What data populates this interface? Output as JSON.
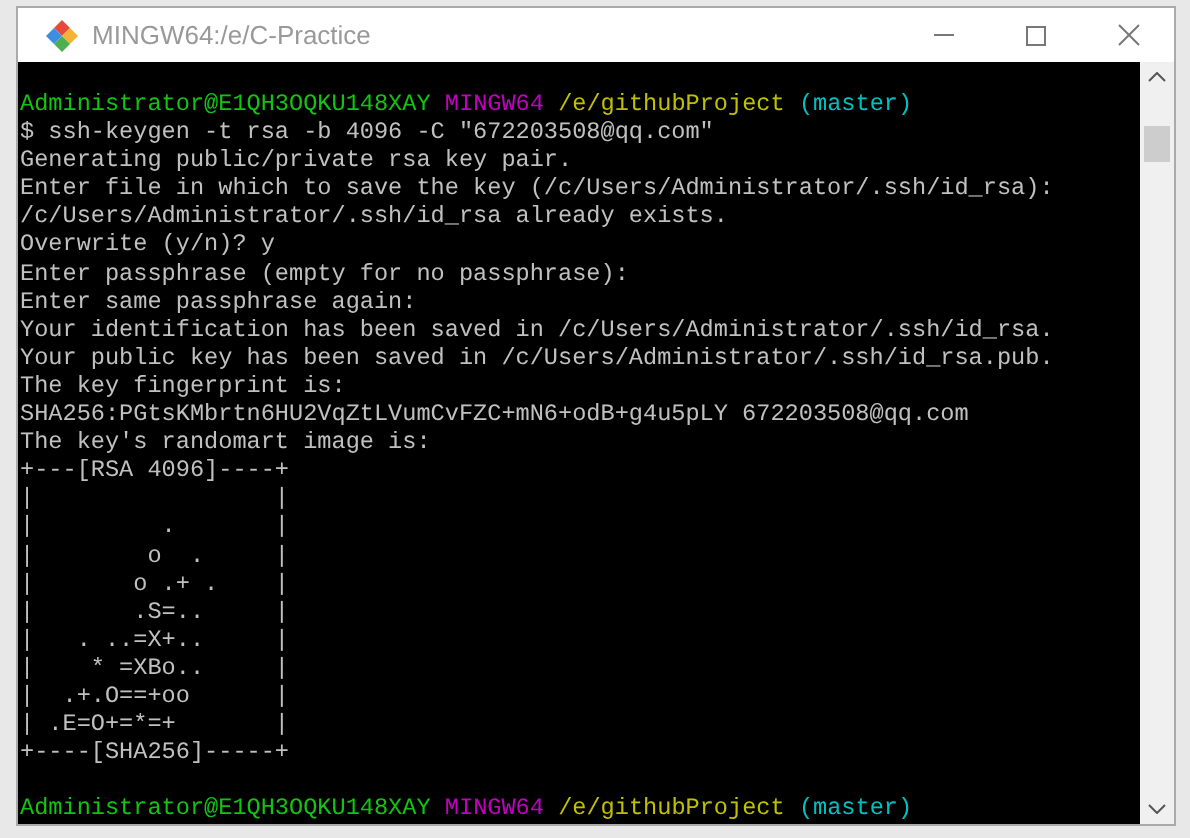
{
  "window": {
    "title": "MINGW64:/e/C-Practice"
  },
  "terminal": {
    "lines": [
      {
        "kind": "prompt",
        "user_host": "Administrator@E1QH3OQKU148XAY",
        "system": "MINGW64",
        "path": "/e/githubProject",
        "branch": "(master)"
      },
      {
        "kind": "output",
        "text": "$ ssh-keygen -t rsa -b 4096 -C \"672203508@qq.com\""
      },
      {
        "kind": "output",
        "text": "Generating public/private rsa key pair."
      },
      {
        "kind": "output",
        "text": "Enter file in which to save the key (/c/Users/Administrator/.ssh/id_rsa):"
      },
      {
        "kind": "output",
        "text": "/c/Users/Administrator/.ssh/id_rsa already exists."
      },
      {
        "kind": "output",
        "text": "Overwrite (y/n)? y"
      },
      {
        "kind": "output",
        "text": "Enter passphrase (empty for no passphrase):"
      },
      {
        "kind": "output",
        "text": "Enter same passphrase again:"
      },
      {
        "kind": "output",
        "text": "Your identification has been saved in /c/Users/Administrator/.ssh/id_rsa."
      },
      {
        "kind": "output",
        "text": "Your public key has been saved in /c/Users/Administrator/.ssh/id_rsa.pub."
      },
      {
        "kind": "output",
        "text": "The key fingerprint is:"
      },
      {
        "kind": "output",
        "text": "SHA256:PGtsKMbrtn6HU2VqZtLVumCvFZC+mN6+odB+g4u5pLY 672203508@qq.com"
      },
      {
        "kind": "output",
        "text": "The key's randomart image is:"
      },
      {
        "kind": "output",
        "text": "+---[RSA 4096]----+"
      },
      {
        "kind": "output",
        "text": "|                 |"
      },
      {
        "kind": "output",
        "text": "|         .       |"
      },
      {
        "kind": "output",
        "text": "|        o  .     |"
      },
      {
        "kind": "output",
        "text": "|       o .+ .    |"
      },
      {
        "kind": "output",
        "text": "|       .S=..     |"
      },
      {
        "kind": "output",
        "text": "|   . ..=X+..     |"
      },
      {
        "kind": "output",
        "text": "|    * =XBo..     |"
      },
      {
        "kind": "output",
        "text": "|  .+.O==+oo      |"
      },
      {
        "kind": "output",
        "text": "| .E=O+=*=+       |"
      },
      {
        "kind": "output",
        "text": "+----[SHA256]-----+"
      },
      {
        "kind": "blank"
      },
      {
        "kind": "prompt",
        "user_host": "Administrator@E1QH3OQKU148XAY",
        "system": "MINGW64",
        "path": "/e/githubProject",
        "branch": "(master)"
      }
    ]
  }
}
